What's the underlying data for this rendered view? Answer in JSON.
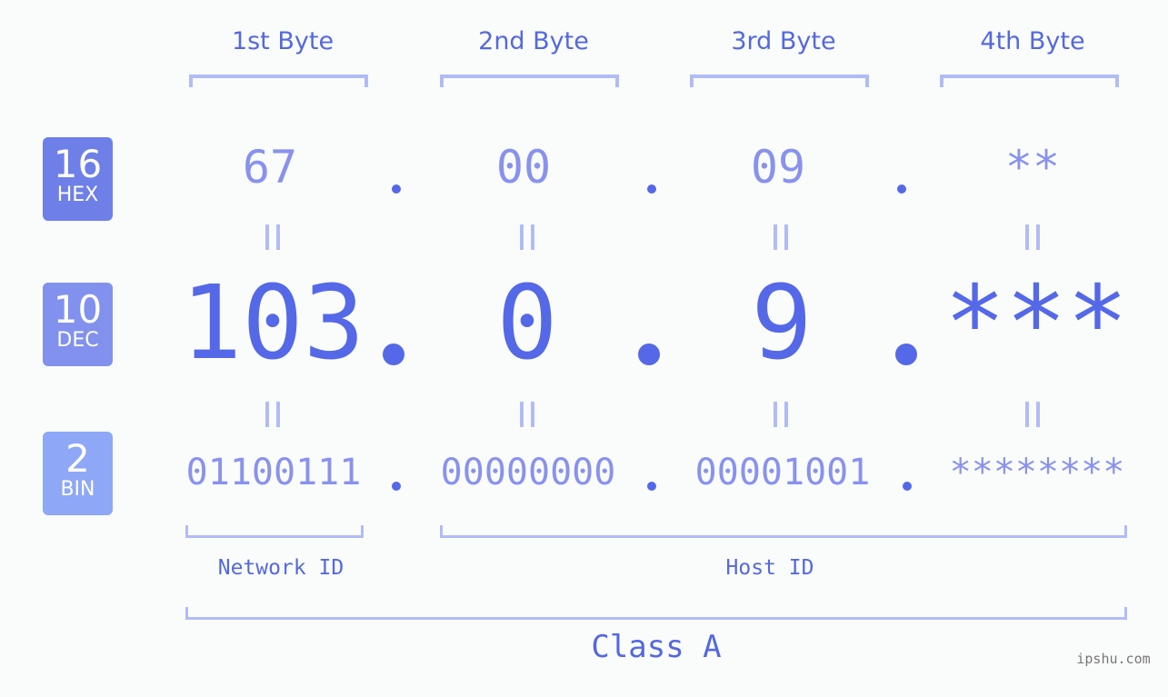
{
  "bytes": [
    {
      "label": "1st Byte",
      "hex": "67",
      "dec": "103",
      "bin": "01100111"
    },
    {
      "label": "2nd Byte",
      "hex": "00",
      "dec": "0",
      "bin": "00000000"
    },
    {
      "label": "3rd Byte",
      "hex": "09",
      "dec": "9",
      "bin": "00001001"
    },
    {
      "label": "4th Byte",
      "hex": "**",
      "dec": "***",
      "bin": "********"
    }
  ],
  "badges": {
    "hex": {
      "num": "16",
      "label": "HEX",
      "color": "#6e7fe8"
    },
    "dec": {
      "num": "10",
      "label": "DEC",
      "color": "#8291ee"
    },
    "bin": {
      "num": "2",
      "label": "BIN",
      "color": "#8ea7f6"
    }
  },
  "network_id_label": "Network ID",
  "host_id_label": "Host ID",
  "class_label": "Class A",
  "watermark": "ipshu.com",
  "colors": {
    "accent": "#5468e8",
    "light": "#8892ee",
    "bracket": "#b1bcf6"
  }
}
